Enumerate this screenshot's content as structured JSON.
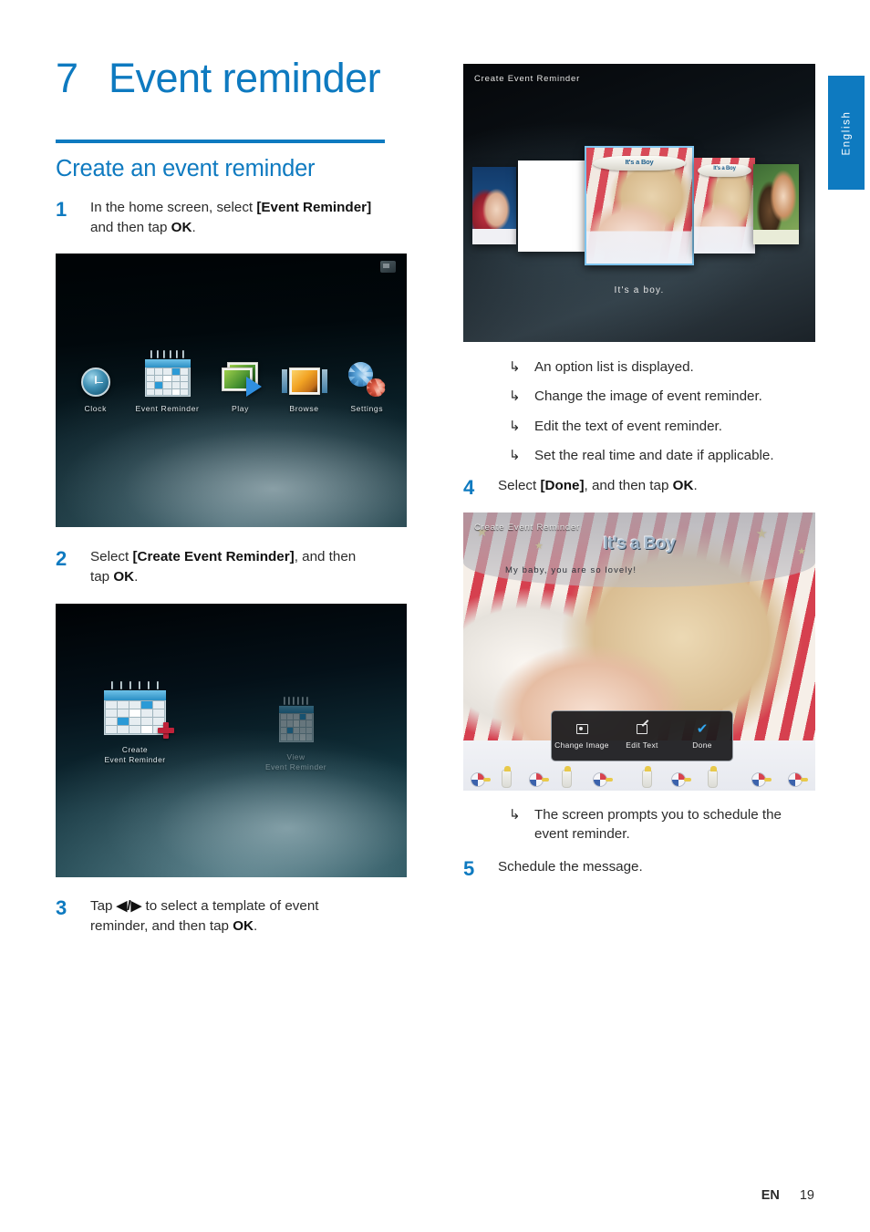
{
  "language_tab": {
    "label": "English"
  },
  "chapter": {
    "number": "7",
    "title": "Event reminder"
  },
  "section": {
    "title": "Create an event reminder"
  },
  "steps": [
    {
      "number": "1",
      "text_parts": [
        "In the home screen, select ",
        "[Event Reminder]",
        " and then tap ",
        "OK",
        "."
      ]
    },
    {
      "number": "2",
      "text_parts": [
        "Select ",
        "[Create Event Reminder]",
        ", and then tap ",
        "OK",
        "."
      ]
    },
    {
      "number": "3",
      "text_parts": [
        "Tap ",
        "◀/▶",
        " to select a template of event reminder, and then tap ",
        "OK",
        "."
      ]
    },
    {
      "number": "4",
      "text_parts": [
        "Select ",
        "[Done]",
        ", and then tap ",
        "OK",
        "."
      ]
    },
    {
      "number": "5",
      "text_parts": [
        "Schedule the message."
      ]
    }
  ],
  "step1_text": {
    "a": "In the home screen, select ",
    "b": "[Event",
    "c": "Reminder]",
    "d": " and then tap ",
    "e": "OK",
    "f": "."
  },
  "step2_text": {
    "a": "Select ",
    "b": "[Create Event Reminder]",
    "c": ", and then tap ",
    "d": "OK",
    "e": "."
  },
  "step3_text": {
    "a": "Tap ",
    "b": "◀/▶",
    "c": " to select a template of event reminder, and then tap ",
    "d": "OK",
    "e": "."
  },
  "step4_text": {
    "a": "Select ",
    "b": "[Done]",
    "c": ", and then tap ",
    "d": "OK",
    "e": "."
  },
  "step5_text": {
    "a": "Schedule the message."
  },
  "bullets_after_step3": [
    {
      "marker": "↳",
      "text": "An option list is displayed."
    },
    {
      "marker": "↳",
      "text": "Change the image of event reminder."
    },
    {
      "marker": "↳",
      "text": "Edit the text of event reminder."
    },
    {
      "marker": "↳",
      "text": "Set the real time and date if applicable."
    }
  ],
  "bullets_after_step4": [
    {
      "marker": "↳",
      "text": "The screen prompts you to schedule the event reminder."
    }
  ],
  "screenshot_home": {
    "status_icon": "sd-card-icon",
    "items": [
      {
        "icon": "clock-icon",
        "label": "Clock"
      },
      {
        "icon": "calendar-icon",
        "label": "Event Reminder"
      },
      {
        "icon": "play-icon",
        "label": "Play"
      },
      {
        "icon": "browse-icon",
        "label": "Browse"
      },
      {
        "icon": "settings-gears-icon",
        "label": "Settings"
      }
    ]
  },
  "screenshot_create": {
    "items": [
      {
        "icon": "calendar-plus-icon",
        "label_line1": "Create",
        "label_line2": "Event Reminder",
        "selected": true
      },
      {
        "icon": "calendar-icon",
        "label_line1": "View",
        "label_line2": "Event Reminder",
        "selected": false
      }
    ]
  },
  "screenshot_templates": {
    "title": "Create Event Reminder",
    "caption": "It's a boy.",
    "thumbnails": [
      {
        "name": "christmas-template",
        "banner": ""
      },
      {
        "name": "blank-template",
        "banner": ""
      },
      {
        "name": "its-a-boy-template",
        "banner": "It's a Boy",
        "selected": true
      },
      {
        "name": "its-a-boy-template-2",
        "banner": "It's a Boy"
      },
      {
        "name": "party-template",
        "banner": ""
      }
    ]
  },
  "screenshot_done": {
    "title": "Create Event Reminder",
    "banner_title": "It's a Boy",
    "message": "My baby, you are so lovely!",
    "option_bar": [
      {
        "icon": "change-image-icon",
        "label": "Change Image"
      },
      {
        "icon": "edit-text-icon",
        "label": "Edit Text"
      },
      {
        "icon": "check-icon",
        "label": "Done"
      }
    ]
  },
  "footer": {
    "language_code": "EN",
    "page_number": "19"
  },
  "colors": {
    "accent_blue": "#0e7ac0",
    "text": "#2b2b2b",
    "check_blue": "#33a7ef"
  }
}
